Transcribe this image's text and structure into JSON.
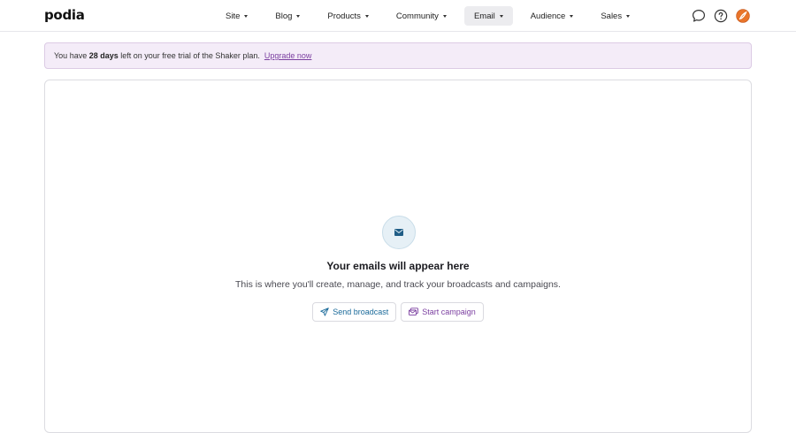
{
  "brand": {
    "name": "podia"
  },
  "nav": {
    "items": [
      {
        "label": "Site"
      },
      {
        "label": "Blog"
      },
      {
        "label": "Products"
      },
      {
        "label": "Community"
      },
      {
        "label": "Email",
        "active": true
      },
      {
        "label": "Audience"
      },
      {
        "label": "Sales"
      }
    ]
  },
  "header_icons": [
    "chat-bubble-icon",
    "help-circle-icon",
    "user-avatar-icon"
  ],
  "banner": {
    "prefix": "You have",
    "days": "28 days",
    "suffix": "left on your free trial of the Shaker plan.",
    "link": "Upgrade now"
  },
  "empty_state": {
    "icon": "envelope-icon",
    "title": "Your emails will appear here",
    "description": "This is where you'll create, manage, and track your broadcasts and campaigns."
  },
  "actions": {
    "broadcast_label": "Send broadcast",
    "campaign_label": "Start campaign"
  },
  "colors": {
    "banner_bg": "#f4ecf8",
    "link_purple": "#7b3fa0",
    "broadcast_blue": "#1a6a9a",
    "avatar_orange": "#e8742a"
  }
}
